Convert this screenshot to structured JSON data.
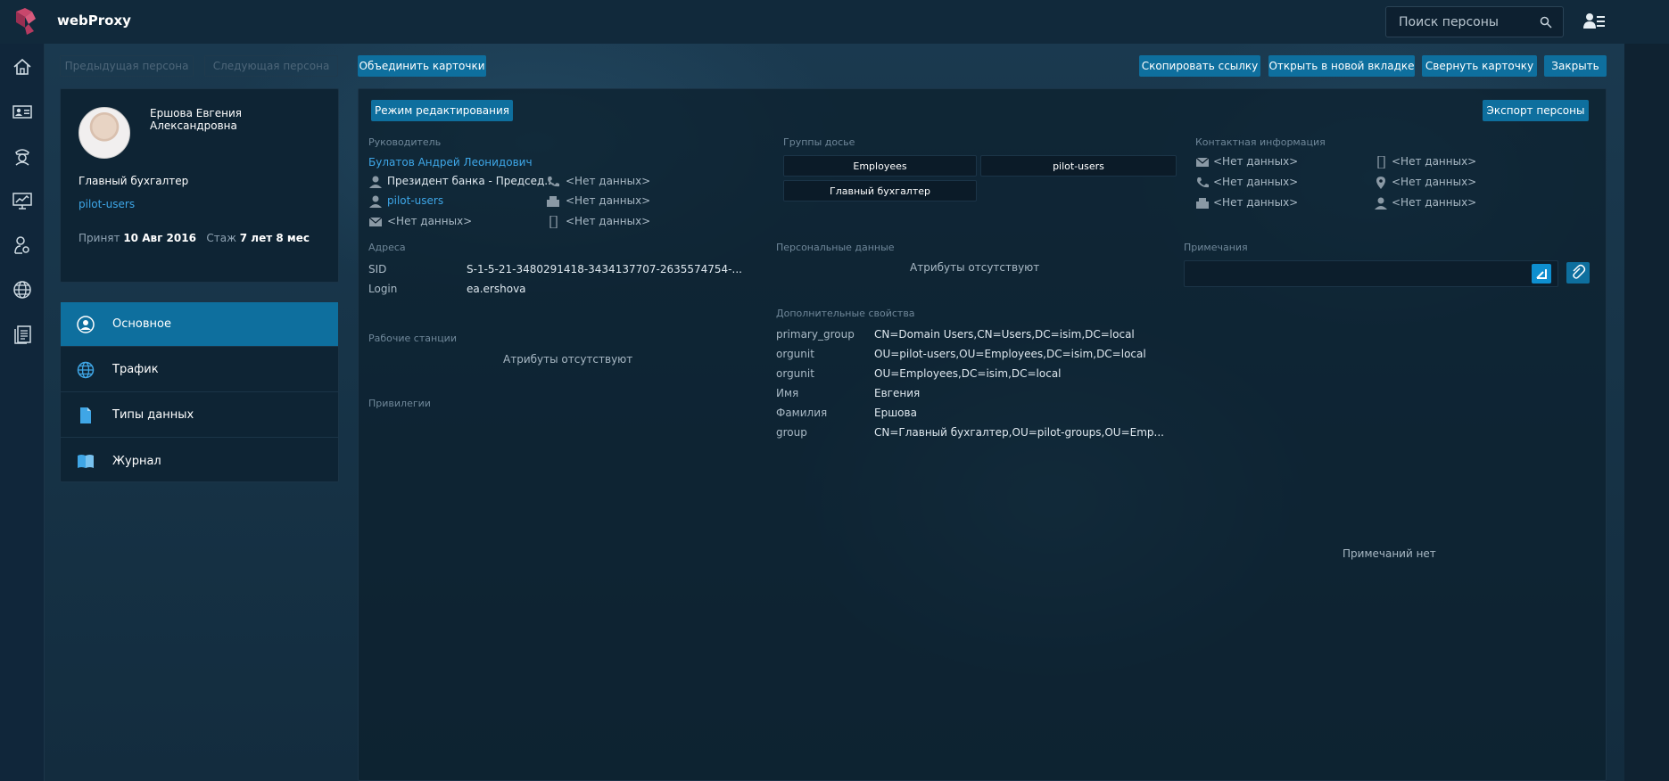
{
  "app": {
    "title": "webProxy"
  },
  "search": {
    "placeholder": "Поиск персоны"
  },
  "rail": [
    {
      "icon": "home-icon"
    },
    {
      "icon": "id-card-icon"
    },
    {
      "icon": "officer-icon"
    },
    {
      "icon": "chart-monitor-icon"
    },
    {
      "icon": "user-settings-icon"
    },
    {
      "icon": "globe-icon"
    },
    {
      "icon": "documents-icon"
    }
  ],
  "toolbar": {
    "prev": "Предыдущая персона",
    "next": "Следующая персона",
    "merge": "Объединить карточки",
    "copy_link": "Скопировать ссылку",
    "open_tab": "Открыть в новой вкладке",
    "collapse": "Свернуть карточку",
    "close": "Закрыть"
  },
  "person": {
    "name_line1": "Ершова Евгения",
    "name_line2": "Александровна",
    "position": "Главный бухгалтер",
    "group": "pilot-users",
    "hired_label": "Принят",
    "hired_date": "10 Авг 2016",
    "tenure_label": "Стаж",
    "tenure": "7 лет 8 мес"
  },
  "nav": [
    {
      "label": "Основное",
      "icon": "user-circle-icon",
      "active": true
    },
    {
      "label": "Трафик",
      "icon": "globe-icon",
      "active": false
    },
    {
      "label": "Типы данных",
      "icon": "file-icon",
      "active": false
    },
    {
      "label": "Журнал",
      "icon": "book-icon",
      "active": false
    }
  ],
  "main": {
    "edit_mode": "Режим редактирования",
    "export": "Экспорт персоны",
    "manager": {
      "label": "Руководитель",
      "name": "Булатов Андрей Леонидович",
      "title": "Президент банка - Председ...",
      "group": "pilot-users",
      "email": "<Нет данных>",
      "phone": "<Нет данных>",
      "fax": "<Нет данных>",
      "mobile": "<Нет данных>"
    },
    "groups": {
      "label": "Группы досье",
      "items": [
        "Employees",
        "pilot-users",
        "Главный бухгалтер"
      ]
    },
    "contacts": {
      "label": "Контактная информация",
      "email": "<Нет данных>",
      "mobile": "<Нет данных>",
      "phone": "<Нет данных>",
      "location": "<Нет данных>",
      "fax": "<Нет данных>",
      "person": "<Нет данных>"
    },
    "addresses": {
      "label": "Адреса",
      "rows": [
        {
          "key": "SID",
          "value": "S-1-5-21-3480291418-3434137707-2635574754-..."
        },
        {
          "key": "Login",
          "value": "ea.ershova"
        }
      ]
    },
    "personal": {
      "label": "Персональные данные",
      "empty": "Атрибуты отсутствуют"
    },
    "notes": {
      "label": "Примечания",
      "empty": "Примечаний нет"
    },
    "workstations": {
      "label": "Рабочие станции",
      "empty": "Атрибуты отсутствуют"
    },
    "extra": {
      "label": "Дополнительные свойства",
      "rows": [
        {
          "key": "primary_group",
          "value": "CN=Domain Users,CN=Users,DC=isim,DC=local"
        },
        {
          "key": "orgunit",
          "value": "OU=pilot-users,OU=Employees,DC=isim,DC=local"
        },
        {
          "key": "orgunit",
          "value": "OU=Employees,DC=isim,DC=local"
        },
        {
          "key": "Имя",
          "value": "Евгения"
        },
        {
          "key": "Фамилия",
          "value": "Ершова"
        },
        {
          "key": "group",
          "value": "CN=Главный бухгалтер,OU=pilot-groups,OU=Emp..."
        }
      ]
    },
    "privileges": {
      "label": "Привилегии"
    }
  }
}
